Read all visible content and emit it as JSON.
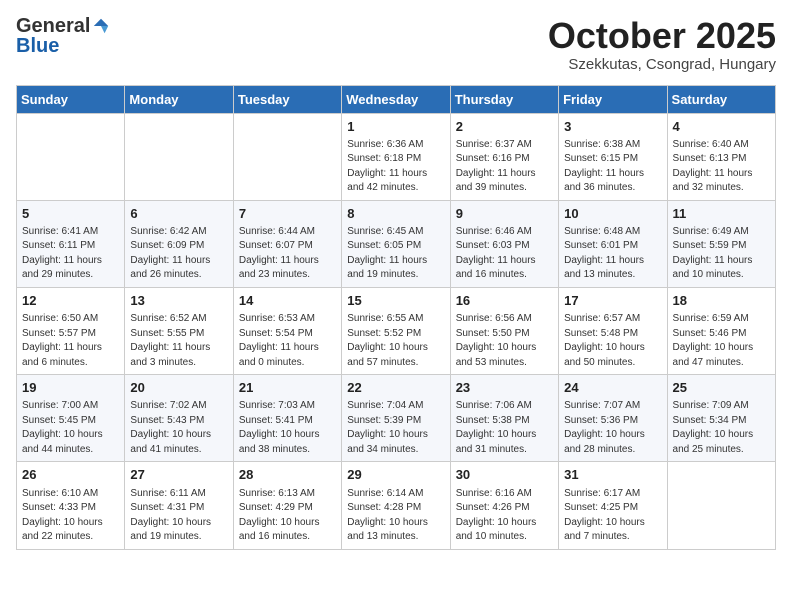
{
  "header": {
    "logo_general": "General",
    "logo_blue": "Blue",
    "month_title": "October 2025",
    "location": "Szekkutas, Csongrad, Hungary"
  },
  "days_of_week": [
    "Sunday",
    "Monday",
    "Tuesday",
    "Wednesday",
    "Thursday",
    "Friday",
    "Saturday"
  ],
  "weeks": [
    [
      {
        "day": "",
        "info": ""
      },
      {
        "day": "",
        "info": ""
      },
      {
        "day": "",
        "info": ""
      },
      {
        "day": "1",
        "info": "Sunrise: 6:36 AM\nSunset: 6:18 PM\nDaylight: 11 hours\nand 42 minutes."
      },
      {
        "day": "2",
        "info": "Sunrise: 6:37 AM\nSunset: 6:16 PM\nDaylight: 11 hours\nand 39 minutes."
      },
      {
        "day": "3",
        "info": "Sunrise: 6:38 AM\nSunset: 6:15 PM\nDaylight: 11 hours\nand 36 minutes."
      },
      {
        "day": "4",
        "info": "Sunrise: 6:40 AM\nSunset: 6:13 PM\nDaylight: 11 hours\nand 32 minutes."
      }
    ],
    [
      {
        "day": "5",
        "info": "Sunrise: 6:41 AM\nSunset: 6:11 PM\nDaylight: 11 hours\nand 29 minutes."
      },
      {
        "day": "6",
        "info": "Sunrise: 6:42 AM\nSunset: 6:09 PM\nDaylight: 11 hours\nand 26 minutes."
      },
      {
        "day": "7",
        "info": "Sunrise: 6:44 AM\nSunset: 6:07 PM\nDaylight: 11 hours\nand 23 minutes."
      },
      {
        "day": "8",
        "info": "Sunrise: 6:45 AM\nSunset: 6:05 PM\nDaylight: 11 hours\nand 19 minutes."
      },
      {
        "day": "9",
        "info": "Sunrise: 6:46 AM\nSunset: 6:03 PM\nDaylight: 11 hours\nand 16 minutes."
      },
      {
        "day": "10",
        "info": "Sunrise: 6:48 AM\nSunset: 6:01 PM\nDaylight: 11 hours\nand 13 minutes."
      },
      {
        "day": "11",
        "info": "Sunrise: 6:49 AM\nSunset: 5:59 PM\nDaylight: 11 hours\nand 10 minutes."
      }
    ],
    [
      {
        "day": "12",
        "info": "Sunrise: 6:50 AM\nSunset: 5:57 PM\nDaylight: 11 hours\nand 6 minutes."
      },
      {
        "day": "13",
        "info": "Sunrise: 6:52 AM\nSunset: 5:55 PM\nDaylight: 11 hours\nand 3 minutes."
      },
      {
        "day": "14",
        "info": "Sunrise: 6:53 AM\nSunset: 5:54 PM\nDaylight: 11 hours\nand 0 minutes."
      },
      {
        "day": "15",
        "info": "Sunrise: 6:55 AM\nSunset: 5:52 PM\nDaylight: 10 hours\nand 57 minutes."
      },
      {
        "day": "16",
        "info": "Sunrise: 6:56 AM\nSunset: 5:50 PM\nDaylight: 10 hours\nand 53 minutes."
      },
      {
        "day": "17",
        "info": "Sunrise: 6:57 AM\nSunset: 5:48 PM\nDaylight: 10 hours\nand 50 minutes."
      },
      {
        "day": "18",
        "info": "Sunrise: 6:59 AM\nSunset: 5:46 PM\nDaylight: 10 hours\nand 47 minutes."
      }
    ],
    [
      {
        "day": "19",
        "info": "Sunrise: 7:00 AM\nSunset: 5:45 PM\nDaylight: 10 hours\nand 44 minutes."
      },
      {
        "day": "20",
        "info": "Sunrise: 7:02 AM\nSunset: 5:43 PM\nDaylight: 10 hours\nand 41 minutes."
      },
      {
        "day": "21",
        "info": "Sunrise: 7:03 AM\nSunset: 5:41 PM\nDaylight: 10 hours\nand 38 minutes."
      },
      {
        "day": "22",
        "info": "Sunrise: 7:04 AM\nSunset: 5:39 PM\nDaylight: 10 hours\nand 34 minutes."
      },
      {
        "day": "23",
        "info": "Sunrise: 7:06 AM\nSunset: 5:38 PM\nDaylight: 10 hours\nand 31 minutes."
      },
      {
        "day": "24",
        "info": "Sunrise: 7:07 AM\nSunset: 5:36 PM\nDaylight: 10 hours\nand 28 minutes."
      },
      {
        "day": "25",
        "info": "Sunrise: 7:09 AM\nSunset: 5:34 PM\nDaylight: 10 hours\nand 25 minutes."
      }
    ],
    [
      {
        "day": "26",
        "info": "Sunrise: 6:10 AM\nSunset: 4:33 PM\nDaylight: 10 hours\nand 22 minutes."
      },
      {
        "day": "27",
        "info": "Sunrise: 6:11 AM\nSunset: 4:31 PM\nDaylight: 10 hours\nand 19 minutes."
      },
      {
        "day": "28",
        "info": "Sunrise: 6:13 AM\nSunset: 4:29 PM\nDaylight: 10 hours\nand 16 minutes."
      },
      {
        "day": "29",
        "info": "Sunrise: 6:14 AM\nSunset: 4:28 PM\nDaylight: 10 hours\nand 13 minutes."
      },
      {
        "day": "30",
        "info": "Sunrise: 6:16 AM\nSunset: 4:26 PM\nDaylight: 10 hours\nand 10 minutes."
      },
      {
        "day": "31",
        "info": "Sunrise: 6:17 AM\nSunset: 4:25 PM\nDaylight: 10 hours\nand 7 minutes."
      },
      {
        "day": "",
        "info": ""
      }
    ]
  ]
}
